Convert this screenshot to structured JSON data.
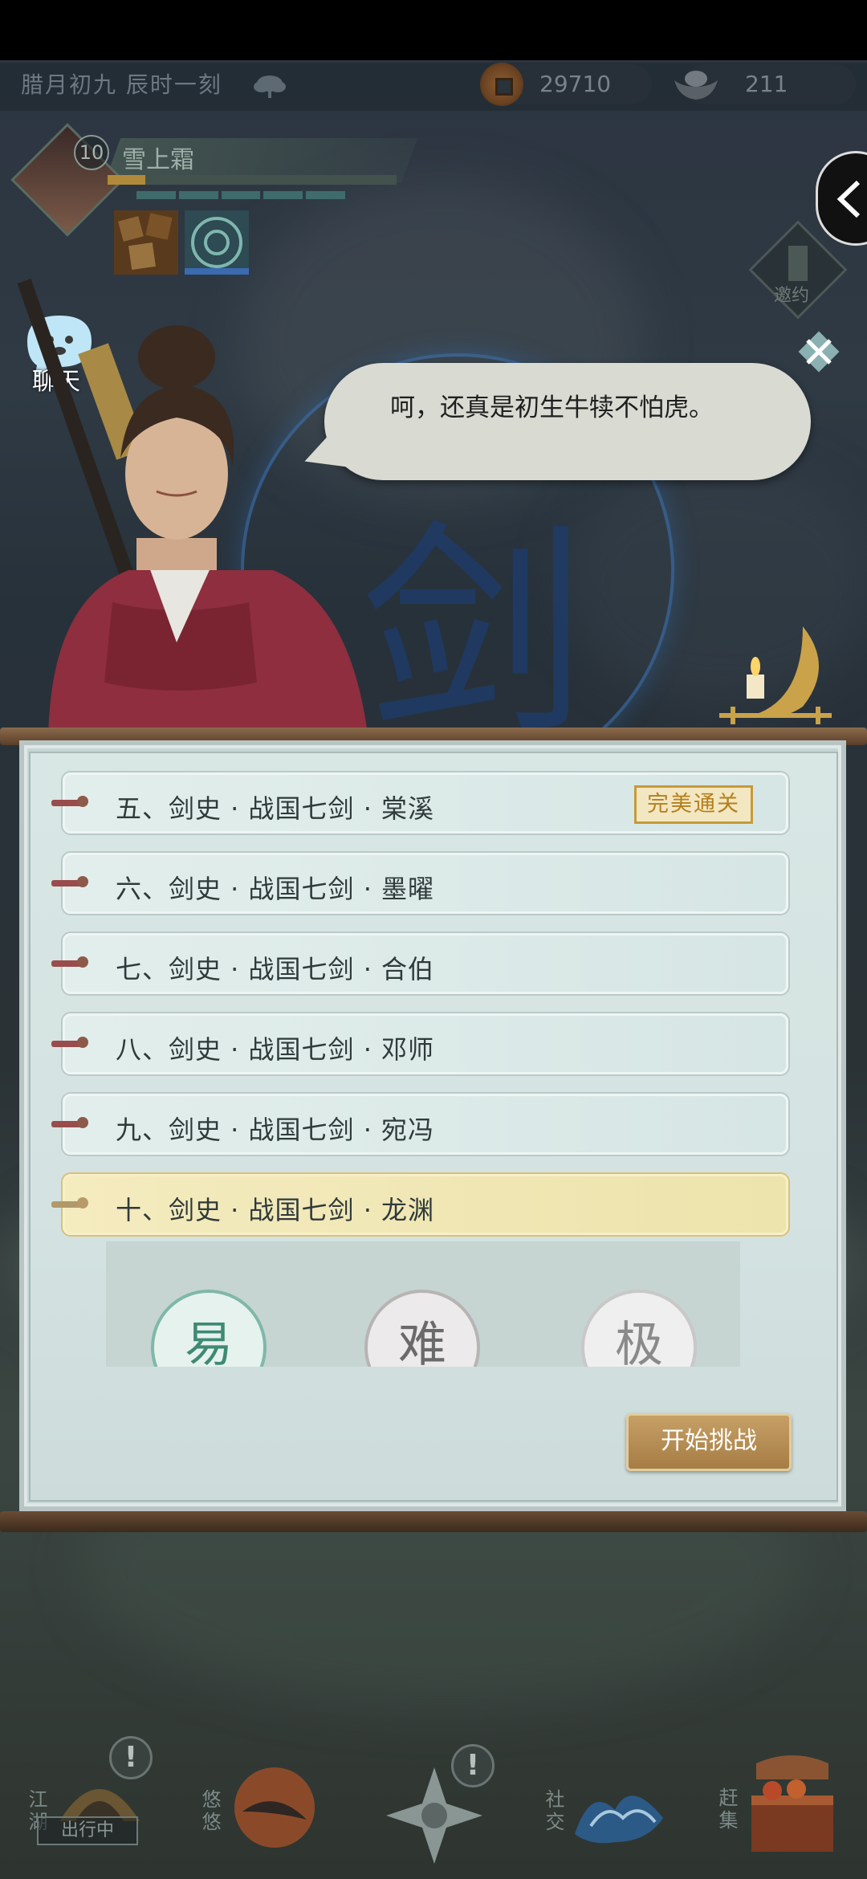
{
  "topbar": {
    "date": "腊月初九  辰时一刻",
    "coins": "29710",
    "ingots": "211"
  },
  "player": {
    "level": "10",
    "name": "雪上霜",
    "exp_fraction": 0.13
  },
  "chat": {
    "label": "聊天"
  },
  "invite": {
    "label": "邀约"
  },
  "dialog": {
    "text": "呵，还真是初生牛犊不怕虎。"
  },
  "levels": [
    {
      "label": "五、剑史 · 战国七剑 · 棠溪",
      "badge": "完美通关"
    },
    {
      "label": "六、剑史 · 战国七剑 · 墨曜"
    },
    {
      "label": "七、剑史 · 战国七剑 · 合伯"
    },
    {
      "label": "八、剑史 · 战国七剑 · 邓师"
    },
    {
      "label": "九、剑史 · 战国七剑 · 宛冯"
    },
    {
      "label": "十、剑史 · 战国七剑 · 龙渊"
    }
  ],
  "difficulty": {
    "easy": "易",
    "hard": "难",
    "extreme": "极"
  },
  "start_button": "开始挑战",
  "nav": {
    "jianghu": "江湖",
    "outing": "出行中",
    "youyou": "悠悠",
    "social": "社交",
    "market": "赶集",
    "alert": "!"
  },
  "colors": {
    "panel_bg": "#d8e6e4",
    "selected_row": "#f4ebbf",
    "badge_gold": "#c79a3a",
    "start_btn": "#b48c52"
  }
}
